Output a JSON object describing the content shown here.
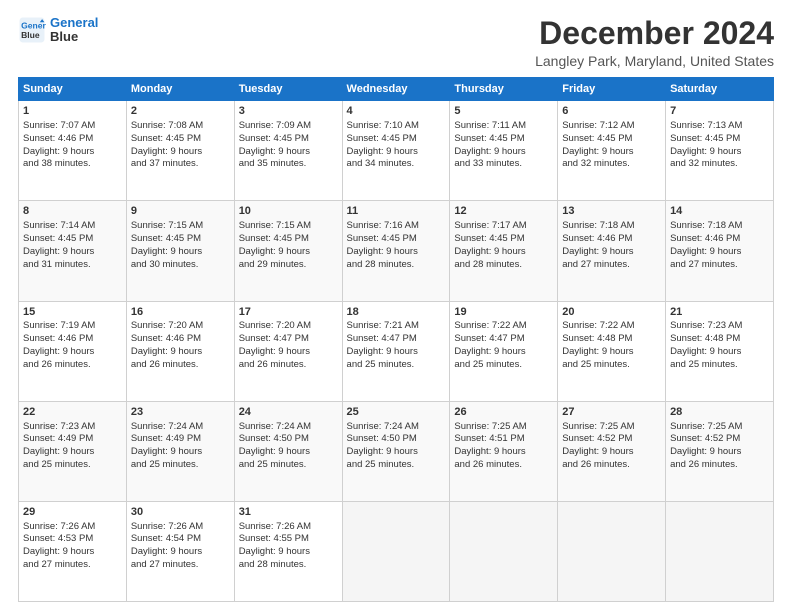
{
  "logo": {
    "line1": "General",
    "line2": "Blue"
  },
  "title": "December 2024",
  "location": "Langley Park, Maryland, United States",
  "days_header": [
    "Sunday",
    "Monday",
    "Tuesday",
    "Wednesday",
    "Thursday",
    "Friday",
    "Saturday"
  ],
  "weeks": [
    [
      {
        "day": 1,
        "lines": [
          "Sunrise: 7:07 AM",
          "Sunset: 4:46 PM",
          "Daylight: 9 hours",
          "and 38 minutes."
        ]
      },
      {
        "day": 2,
        "lines": [
          "Sunrise: 7:08 AM",
          "Sunset: 4:45 PM",
          "Daylight: 9 hours",
          "and 37 minutes."
        ]
      },
      {
        "day": 3,
        "lines": [
          "Sunrise: 7:09 AM",
          "Sunset: 4:45 PM",
          "Daylight: 9 hours",
          "and 35 minutes."
        ]
      },
      {
        "day": 4,
        "lines": [
          "Sunrise: 7:10 AM",
          "Sunset: 4:45 PM",
          "Daylight: 9 hours",
          "and 34 minutes."
        ]
      },
      {
        "day": 5,
        "lines": [
          "Sunrise: 7:11 AM",
          "Sunset: 4:45 PM",
          "Daylight: 9 hours",
          "and 33 minutes."
        ]
      },
      {
        "day": 6,
        "lines": [
          "Sunrise: 7:12 AM",
          "Sunset: 4:45 PM",
          "Daylight: 9 hours",
          "and 32 minutes."
        ]
      },
      {
        "day": 7,
        "lines": [
          "Sunrise: 7:13 AM",
          "Sunset: 4:45 PM",
          "Daylight: 9 hours",
          "and 32 minutes."
        ]
      }
    ],
    [
      {
        "day": 8,
        "lines": [
          "Sunrise: 7:14 AM",
          "Sunset: 4:45 PM",
          "Daylight: 9 hours",
          "and 31 minutes."
        ]
      },
      {
        "day": 9,
        "lines": [
          "Sunrise: 7:15 AM",
          "Sunset: 4:45 PM",
          "Daylight: 9 hours",
          "and 30 minutes."
        ]
      },
      {
        "day": 10,
        "lines": [
          "Sunrise: 7:15 AM",
          "Sunset: 4:45 PM",
          "Daylight: 9 hours",
          "and 29 minutes."
        ]
      },
      {
        "day": 11,
        "lines": [
          "Sunrise: 7:16 AM",
          "Sunset: 4:45 PM",
          "Daylight: 9 hours",
          "and 28 minutes."
        ]
      },
      {
        "day": 12,
        "lines": [
          "Sunrise: 7:17 AM",
          "Sunset: 4:45 PM",
          "Daylight: 9 hours",
          "and 28 minutes."
        ]
      },
      {
        "day": 13,
        "lines": [
          "Sunrise: 7:18 AM",
          "Sunset: 4:46 PM",
          "Daylight: 9 hours",
          "and 27 minutes."
        ]
      },
      {
        "day": 14,
        "lines": [
          "Sunrise: 7:18 AM",
          "Sunset: 4:46 PM",
          "Daylight: 9 hours",
          "and 27 minutes."
        ]
      }
    ],
    [
      {
        "day": 15,
        "lines": [
          "Sunrise: 7:19 AM",
          "Sunset: 4:46 PM",
          "Daylight: 9 hours",
          "and 26 minutes."
        ]
      },
      {
        "day": 16,
        "lines": [
          "Sunrise: 7:20 AM",
          "Sunset: 4:46 PM",
          "Daylight: 9 hours",
          "and 26 minutes."
        ]
      },
      {
        "day": 17,
        "lines": [
          "Sunrise: 7:20 AM",
          "Sunset: 4:47 PM",
          "Daylight: 9 hours",
          "and 26 minutes."
        ]
      },
      {
        "day": 18,
        "lines": [
          "Sunrise: 7:21 AM",
          "Sunset: 4:47 PM",
          "Daylight: 9 hours",
          "and 25 minutes."
        ]
      },
      {
        "day": 19,
        "lines": [
          "Sunrise: 7:22 AM",
          "Sunset: 4:47 PM",
          "Daylight: 9 hours",
          "and 25 minutes."
        ]
      },
      {
        "day": 20,
        "lines": [
          "Sunrise: 7:22 AM",
          "Sunset: 4:48 PM",
          "Daylight: 9 hours",
          "and 25 minutes."
        ]
      },
      {
        "day": 21,
        "lines": [
          "Sunrise: 7:23 AM",
          "Sunset: 4:48 PM",
          "Daylight: 9 hours",
          "and 25 minutes."
        ]
      }
    ],
    [
      {
        "day": 22,
        "lines": [
          "Sunrise: 7:23 AM",
          "Sunset: 4:49 PM",
          "Daylight: 9 hours",
          "and 25 minutes."
        ]
      },
      {
        "day": 23,
        "lines": [
          "Sunrise: 7:24 AM",
          "Sunset: 4:49 PM",
          "Daylight: 9 hours",
          "and 25 minutes."
        ]
      },
      {
        "day": 24,
        "lines": [
          "Sunrise: 7:24 AM",
          "Sunset: 4:50 PM",
          "Daylight: 9 hours",
          "and 25 minutes."
        ]
      },
      {
        "day": 25,
        "lines": [
          "Sunrise: 7:24 AM",
          "Sunset: 4:50 PM",
          "Daylight: 9 hours",
          "and 25 minutes."
        ]
      },
      {
        "day": 26,
        "lines": [
          "Sunrise: 7:25 AM",
          "Sunset: 4:51 PM",
          "Daylight: 9 hours",
          "and 26 minutes."
        ]
      },
      {
        "day": 27,
        "lines": [
          "Sunrise: 7:25 AM",
          "Sunset: 4:52 PM",
          "Daylight: 9 hours",
          "and 26 minutes."
        ]
      },
      {
        "day": 28,
        "lines": [
          "Sunrise: 7:25 AM",
          "Sunset: 4:52 PM",
          "Daylight: 9 hours",
          "and 26 minutes."
        ]
      }
    ],
    [
      {
        "day": 29,
        "lines": [
          "Sunrise: 7:26 AM",
          "Sunset: 4:53 PM",
          "Daylight: 9 hours",
          "and 27 minutes."
        ]
      },
      {
        "day": 30,
        "lines": [
          "Sunrise: 7:26 AM",
          "Sunset: 4:54 PM",
          "Daylight: 9 hours",
          "and 27 minutes."
        ]
      },
      {
        "day": 31,
        "lines": [
          "Sunrise: 7:26 AM",
          "Sunset: 4:55 PM",
          "Daylight: 9 hours",
          "and 28 minutes."
        ]
      },
      null,
      null,
      null,
      null
    ]
  ]
}
